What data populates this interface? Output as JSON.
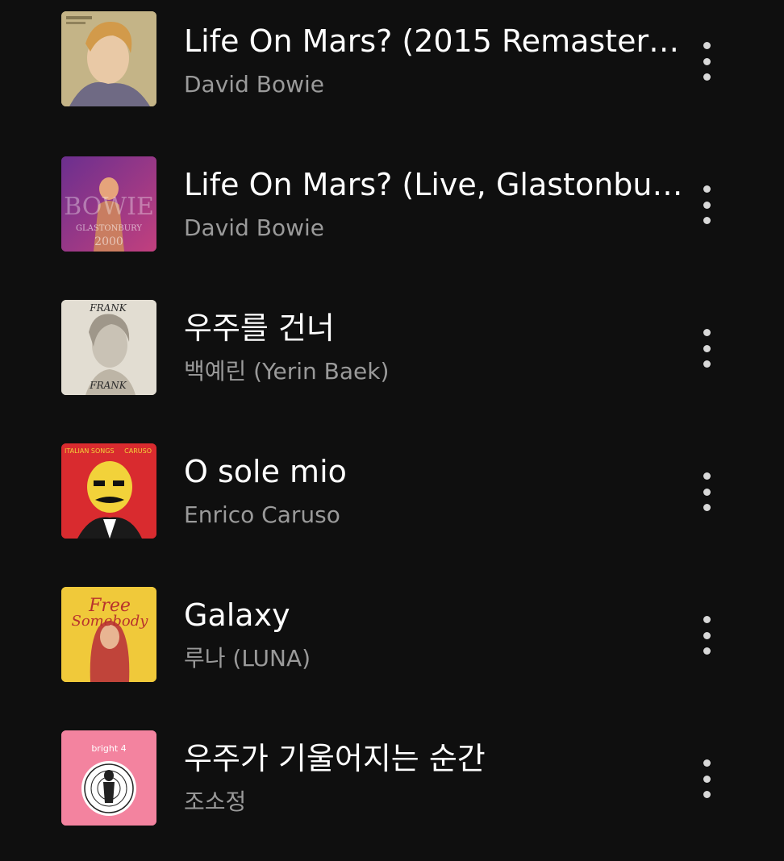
{
  "tracks": [
    {
      "title": "Life On Mars? (2015 Remaster…",
      "artist": "David Bowie",
      "art": "hunky-dory-album-art"
    },
    {
      "title": "Life On Mars? (Live, Glastonbu…",
      "artist": "David Bowie",
      "art": "glastonbury-2000-album-art"
    },
    {
      "title": "우주를 건너",
      "artist": "백예린 (Yerin Baek)",
      "art": "frank-album-art"
    },
    {
      "title": "O sole mio",
      "artist": "Enrico Caruso",
      "art": "italian-songs-caruso-album-art"
    },
    {
      "title": "Galaxy",
      "artist": "루나 (LUNA)",
      "art": "free-somebody-album-art"
    },
    {
      "title": "우주가 기울어지는 순간",
      "artist": "조소정",
      "art": "bright-4-album-art"
    }
  ],
  "art_text": {
    "glastonbury_big": "BOWIE",
    "glastonbury_small": "GLASTONBURY",
    "glastonbury_year": "2000",
    "frank_word": "FRANK",
    "caruso_left": "ITALIAN SONGS",
    "caruso_right": "CARUSO",
    "free_top": "Free",
    "free_bottom": "Somebody",
    "bright_word": "bright 4"
  },
  "menu_icon": "more-vertical-icon",
  "colors": {
    "background": "#0f0f0f",
    "title": "#ffffff",
    "artist": "#9a9a9a",
    "dots": "#d8d8d8"
  }
}
